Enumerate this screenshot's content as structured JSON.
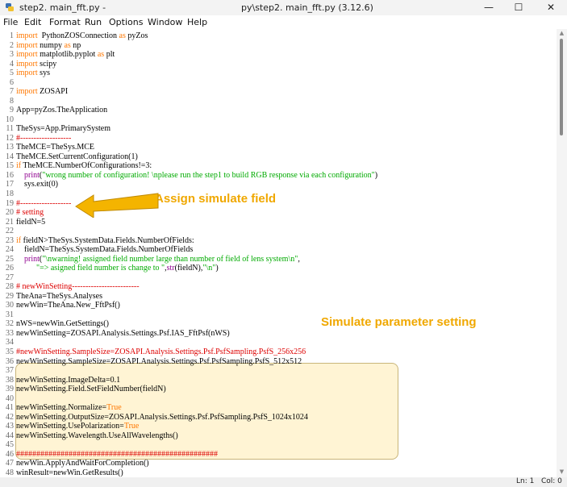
{
  "window": {
    "title_left": "step2. main_fft.py -",
    "title_center": "py\\step2. main_fft.py (3.12.6)",
    "minimize_glyph": "—",
    "maximize_glyph": "☐",
    "close_glyph": "✕"
  },
  "menu": [
    "File",
    "Edit",
    "Format",
    "Run",
    "Options",
    "Window",
    "Help"
  ],
  "status": {
    "ln": "Ln: 1",
    "col": "Col: 0"
  },
  "annotations": {
    "assign": "Assign simulate field",
    "simulate": "Simulate parameter setting"
  },
  "colors": {
    "keyword": "#ff7700",
    "string": "#00aa00",
    "comment": "#dd0000",
    "builtin": "#900090",
    "annotation": "#f0a800",
    "highlight_fill": "#fff2cc"
  },
  "code_lines": [
    [
      [
        "kw",
        "import"
      ],
      [
        "",
        "  PythonZOSConnection "
      ],
      [
        "kw",
        "as"
      ],
      [
        "",
        " pyZos"
      ]
    ],
    [
      [
        "kw",
        "import"
      ],
      [
        "",
        " numpy "
      ],
      [
        "kw",
        "as"
      ],
      [
        "",
        " np"
      ]
    ],
    [
      [
        "kw",
        "import"
      ],
      [
        "",
        " matplotlib.pyplot "
      ],
      [
        "kw",
        "as"
      ],
      [
        "",
        " plt"
      ]
    ],
    [
      [
        "kw",
        "import"
      ],
      [
        "",
        " scipy"
      ]
    ],
    [
      [
        "kw",
        "import"
      ],
      [
        "",
        " sys"
      ]
    ],
    [],
    [
      [
        "kw",
        "import"
      ],
      [
        "",
        " ZOSAPI"
      ]
    ],
    [],
    [
      [
        "",
        "App=pyZos.TheApplication"
      ]
    ],
    [],
    [
      [
        "",
        "TheSys=App.PrimarySystem"
      ]
    ],
    [
      [
        "cm",
        "#-------------------"
      ]
    ],
    [
      [
        "",
        "TheMCE=TheSys.MCE"
      ]
    ],
    [
      [
        "",
        "TheMCE.SetCurrentConfiguration(1)"
      ]
    ],
    [
      [
        "kw",
        "if"
      ],
      [
        "",
        " TheMCE.NumberOfConfigurations!=3:"
      ]
    ],
    [
      [
        "",
        "    "
      ],
      [
        "bi",
        "print"
      ],
      [
        "",
        "("
      ],
      [
        "str",
        "\"wrong number of configuration! \\nplease run the step1 to build RGB response via each configuration\""
      ],
      [
        "",
        ")"
      ]
    ],
    [
      [
        "",
        "    sys.exit(0)"
      ]
    ],
    [],
    [
      [
        "cm",
        "#-------------------"
      ]
    ],
    [
      [
        "cm",
        "# setting"
      ]
    ],
    [
      [
        "",
        "fieldN=5"
      ]
    ],
    [],
    [
      [
        "kw",
        "if"
      ],
      [
        "",
        " fieldN>TheSys.SystemData.Fields.NumberOfFields:"
      ]
    ],
    [
      [
        "",
        "    fieldN=TheSys.SystemData.Fields.NumberOfFields"
      ]
    ],
    [
      [
        "",
        "    "
      ],
      [
        "bi",
        "print"
      ],
      [
        "",
        "("
      ],
      [
        "str",
        "\"\\nwarning! assigned field number large than number of field of lens system\\n\""
      ],
      [
        "",
        ","
      ]
    ],
    [
      [
        "",
        "          "
      ],
      [
        "str",
        "\"=> asigned field number is change to \""
      ],
      [
        "",
        ","
      ],
      [
        "bi",
        "str"
      ],
      [
        "",
        "(fieldN),"
      ],
      [
        "str",
        "\"\\n\""
      ],
      [
        "",
        ")"
      ]
    ],
    [],
    [
      [
        "cm",
        "# newWinSetting-------------------------"
      ]
    ],
    [
      [
        "",
        "TheAna=TheSys.Analyses"
      ]
    ],
    [
      [
        "",
        "newWin=TheAna.New_FftPsf()"
      ]
    ],
    [],
    [
      [
        "",
        "nWS=newWin.GetSettings()"
      ]
    ],
    [
      [
        "",
        "newWinSetting=ZOSAPI.Analysis.Settings.Psf.IAS_FftPsf(nWS)"
      ]
    ],
    [],
    [
      [
        "cm",
        "#newWinSetting.SampleSize=ZOSAPI.Analysis.Settings.Psf.PsfSampling.PsfS_256x256"
      ]
    ],
    [
      [
        "",
        "newWinSetting.SampleSize=ZOSAPI.Analysis.Settings.Psf.PsfSampling.PsfS_512x512"
      ]
    ],
    [],
    [
      [
        "",
        "newWinSetting.ImageDelta=0.1"
      ]
    ],
    [
      [
        "",
        "newWinSetting.Field.SetFieldNumber(fieldN)"
      ]
    ],
    [],
    [
      [
        "",
        "newWinSetting.Normalize="
      ],
      [
        "kw",
        "True"
      ]
    ],
    [
      [
        "",
        "newWinSetting.OutputSize=ZOSAPI.Analysis.Settings.Psf.PsfSampling.PsfS_1024x1024"
      ]
    ],
    [
      [
        "",
        "newWinSetting.UsePolarization="
      ],
      [
        "kw",
        "True"
      ]
    ],
    [
      [
        "",
        "newWinSetting.Wavelength.UseAllWavelengths()"
      ]
    ],
    [],
    [
      [
        "cm",
        "##################################################"
      ]
    ],
    [
      [
        "",
        "newWin.ApplyAndWaitForCompletion()"
      ]
    ],
    [
      [
        "",
        "winResult=newWin.GetResults()"
      ]
    ]
  ]
}
